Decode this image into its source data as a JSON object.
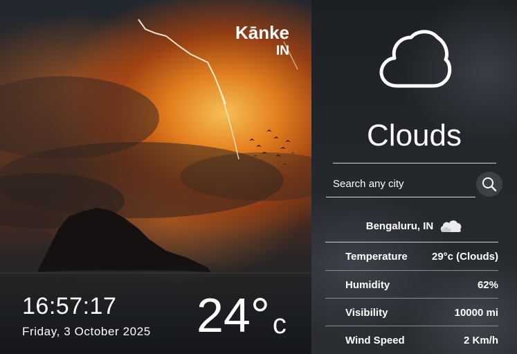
{
  "hero": {
    "city": "Kānke",
    "country": "IN",
    "time": "16:57:17",
    "date": "Friday, 3 October 2025",
    "temperature": "24",
    "degree_symbol": "°",
    "unit": "c"
  },
  "panel": {
    "condition": "Clouds",
    "condition_icon": "cloud-outline-icon",
    "search": {
      "placeholder": "Search any city",
      "button_icon": "search-icon"
    },
    "selected_city": "Bengaluru, IN",
    "selected_city_icon": "cloud-icon",
    "details": [
      {
        "label": "Temperature",
        "value": "29°c (Clouds)"
      },
      {
        "label": "Humidity",
        "value": "62%"
      },
      {
        "label": "Visibility",
        "value": "10000 mi"
      },
      {
        "label": "Wind Speed",
        "value": "2 Km/h"
      }
    ]
  },
  "colors": {
    "panel_bg": "#24272c",
    "text": "#ffffff",
    "sky_glow": "#ff9a2e"
  }
}
